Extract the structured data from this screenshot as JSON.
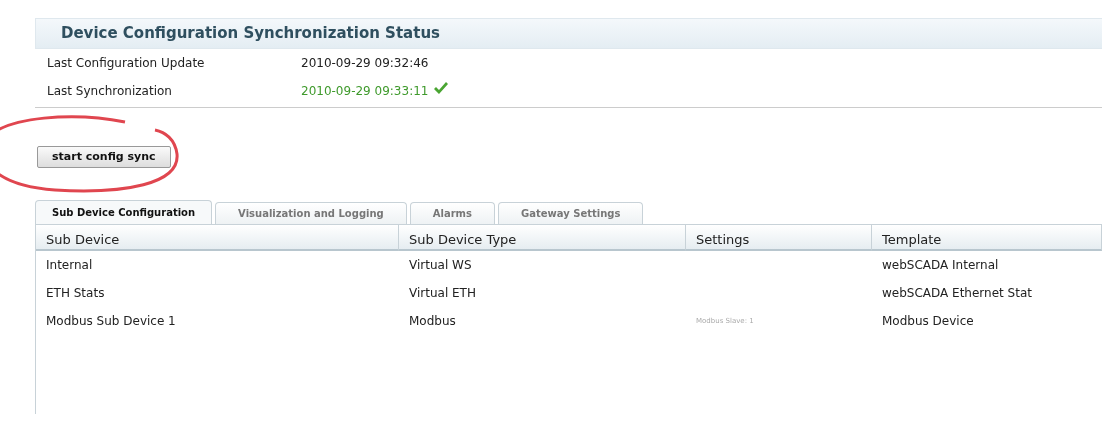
{
  "panel": {
    "title": "Device Configuration Synchronization Status"
  },
  "status_rows": [
    {
      "label": "Last Configuration Update",
      "value": "2010-09-29 09:32:46",
      "ok": false
    },
    {
      "label": "Last Synchronization",
      "value": "2010-09-29 09:33:11",
      "ok": true
    }
  ],
  "sync_button": {
    "label": "start config sync",
    "circled": true
  },
  "tabs": [
    {
      "label": "Sub Device Configuration",
      "selected": true
    },
    {
      "label": "Visualization and Logging",
      "selected": false
    },
    {
      "label": "Alarms",
      "selected": false
    },
    {
      "label": "Gateway Settings",
      "selected": false
    }
  ],
  "table": {
    "columns": [
      "Sub Device",
      "Sub Device Type",
      "Settings",
      "Template"
    ],
    "rows": [
      [
        "Internal",
        "Virtual WS",
        "",
        "webSCADA Internal"
      ],
      [
        "ETH Stats",
        "Virtual ETH",
        "",
        "webSCADA Ethernet Stat"
      ],
      [
        "Modbus Sub Device 1",
        "Modbus",
        "Modbus Slave: 1",
        "Modbus Device"
      ]
    ]
  }
}
